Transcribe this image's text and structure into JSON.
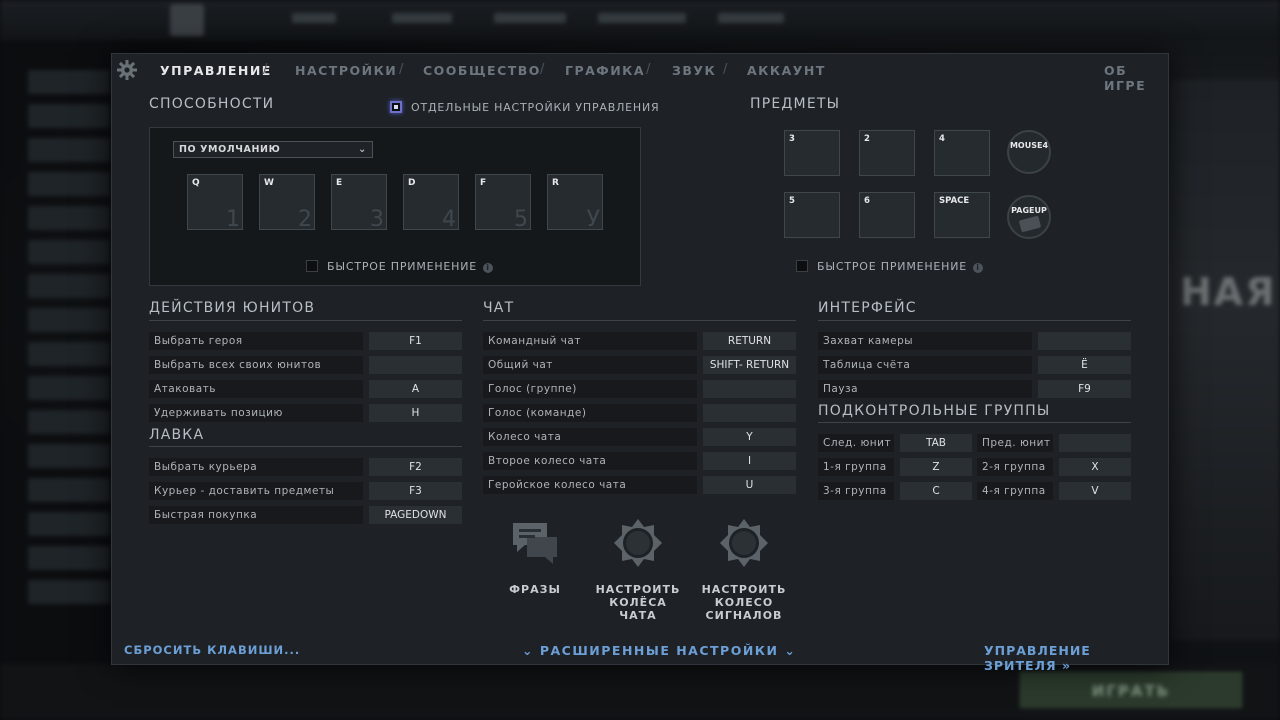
{
  "tabs": {
    "items": [
      "УПРАВЛЕНИЕ",
      "НАСТРОЙКИ",
      "СООБЩЕСТВО",
      "ГРАФИКА",
      "ЗВУК",
      "АККАУНТ"
    ],
    "active": "УПРАВЛЕНИЕ",
    "about": "ОБ ИГРЕ"
  },
  "abilities": {
    "title": "СПОСОБНОСТИ",
    "separate_settings_label": "ОТДЕЛЬНЫЕ НАСТРОЙКИ УПРАВЛЕНИЯ",
    "separate_settings_checked": true,
    "dropdown_value": "ПО УМОЛЧАНИЮ",
    "slots": [
      {
        "key": "Q",
        "num": "1"
      },
      {
        "key": "W",
        "num": "2"
      },
      {
        "key": "E",
        "num": "3"
      },
      {
        "key": "D",
        "num": "4"
      },
      {
        "key": "F",
        "num": "5"
      },
      {
        "key": "R",
        "num": "У"
      }
    ],
    "quickcast_label": "БЫСТРОЕ ПРИМЕНЕНИЕ"
  },
  "items": {
    "title": "ПРЕДМЕТЫ",
    "slots": [
      "3",
      "2",
      "4",
      "5",
      "6",
      "SPACE"
    ],
    "neutral": "MOUSE4",
    "tp": "PAGEUP",
    "quickcast_label": "БЫСТРОЕ ПРИМЕНЕНИЕ"
  },
  "unit_actions": {
    "title": "ДЕЙСТВИЯ ЮНИТОВ",
    "rows": [
      {
        "label": "Выбрать героя",
        "key": "F1"
      },
      {
        "label": "Выбрать всех своих юнитов",
        "key": ""
      },
      {
        "label": "Атаковать",
        "key": "A"
      },
      {
        "label": "Удерживать позицию",
        "key": "H"
      }
    ]
  },
  "shop": {
    "title": "ЛАВКА",
    "rows": [
      {
        "label": "Выбрать курьера",
        "key": "F2"
      },
      {
        "label": "Курьер - доставить предметы",
        "key": "F3"
      },
      {
        "label": "Быстрая покупка",
        "key": "PAGEDOWN"
      }
    ]
  },
  "chat": {
    "title": "ЧАТ",
    "rows": [
      {
        "label": "Командный чат",
        "key": "RETURN"
      },
      {
        "label": "Общий чат",
        "key": "SHIFT- RETURN"
      },
      {
        "label": "Голос (группе)",
        "key": ""
      },
      {
        "label": "Голос (команде)",
        "key": ""
      },
      {
        "label": "Колесо чата",
        "key": "Y"
      },
      {
        "label": "Второе колесо чата",
        "key": "I"
      },
      {
        "label": "Геройское колесо чата",
        "key": "U"
      }
    ],
    "buttons": [
      {
        "lines": [
          "ФРАЗЫ"
        ]
      },
      {
        "lines": [
          "НАСТРОИТЬ",
          "КОЛЁСА ЧАТА"
        ]
      },
      {
        "lines": [
          "НАСТРОИТЬ",
          "КОЛЕСО",
          "СИГНАЛОВ"
        ]
      }
    ]
  },
  "interface": {
    "title": "ИНТЕРФЕЙС",
    "rows": [
      {
        "label": "Захват камеры",
        "key": ""
      },
      {
        "label": "Таблица счёта",
        "key": "Ё"
      },
      {
        "label": "Пауза",
        "key": "F9"
      }
    ]
  },
  "control_groups": {
    "title": "ПОДКОНТРОЛЬНЫЕ ГРУППЫ",
    "rows": [
      {
        "l1": "След. юнит",
        "k1": "TAB",
        "l2": "Пред. юнит",
        "k2": ""
      },
      {
        "l1": "1-я группа",
        "k1": "Z",
        "l2": "2-я группа",
        "k2": "X"
      },
      {
        "l1": "3-я группа",
        "k1": "C",
        "l2": "4-я группа",
        "k2": "V"
      }
    ]
  },
  "footer": {
    "reset": "СБРОСИТЬ КЛАВИШИ...",
    "advanced": "РАСШИРЕННЫЕ НАСТРОЙКИ",
    "spectator": "УПРАВЛЕНИЕ ЗРИТЕЛЯ"
  },
  "background": {
    "play": "ИГРАТЬ",
    "right_word": "НАЯ"
  }
}
